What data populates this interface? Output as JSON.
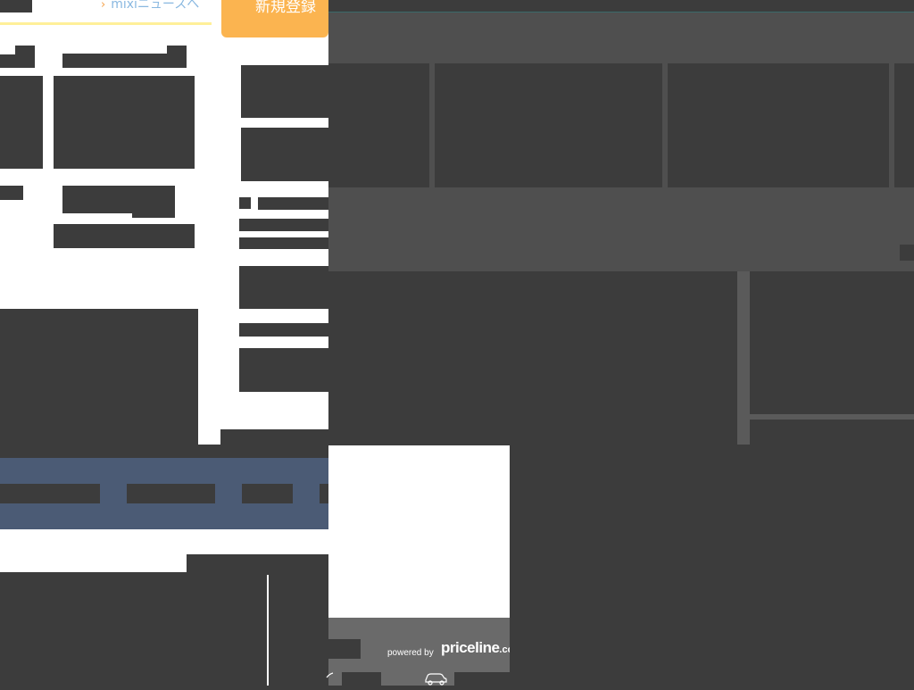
{
  "header": {
    "news_link": "mixiニュースへ",
    "signup_button": "新規登録"
  },
  "promo": {
    "powered_by": "powered by",
    "brand": "priceline",
    "brand_suffix": ".co"
  },
  "icons": {
    "chevron": "chevron-right-icon",
    "car": "car-icon"
  },
  "colors": {
    "page_dark": "#3c3c3c",
    "overlay_mid": "#4f4f4f",
    "signup_orange": "#fbb450",
    "link_blue": "#89b8e0",
    "band_blue": "#4b5b75",
    "priceline_gray": "#6a6a6a",
    "yellow_rule": "#fff099"
  }
}
